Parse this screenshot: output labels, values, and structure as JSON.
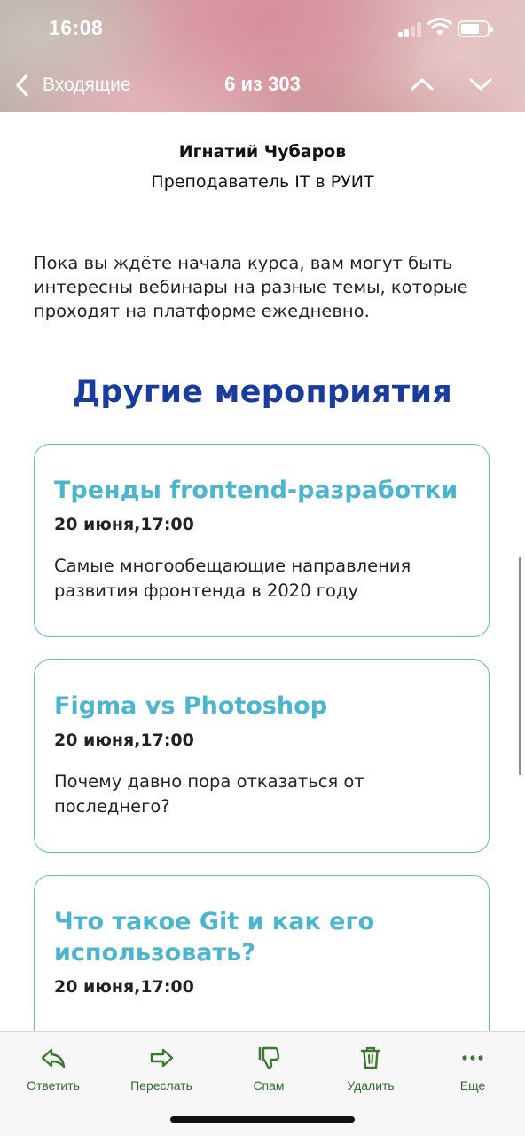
{
  "status_bar": {
    "time": "16:08"
  },
  "nav": {
    "back_label": "Входящие",
    "counter": "6 из 303"
  },
  "sender": {
    "name": "Игнатий Чубаров",
    "role": "Преподаватель IT в РУИТ"
  },
  "intro_text": "Пока вы ждёте начала курса, вам могут быть интересны вебинары на разные темы, которые проходят на платформе ежедневно.",
  "section_title": "Другие мероприятия",
  "events": [
    {
      "title": "Тренды frontend-разработки",
      "date": "20 июня,17:00",
      "description": "Самые многообещающие направления развития фронтенда в 2020 году"
    },
    {
      "title": "Figma vs Photoshop",
      "date": "20 июня,17:00",
      "description": "Почему давно пора отказаться от последнего?"
    },
    {
      "title": "Что такое Git и как его использовать?",
      "date": "20 июня,17:00",
      "description": ""
    }
  ],
  "toolbar": {
    "reply": "Ответить",
    "forward": "Переслать",
    "spam": "Спам",
    "delete": "Удалить",
    "more": "Еще"
  },
  "colors": {
    "title_blue": "#1a3c9c",
    "card_accent": "#4cb6cf",
    "toolbar_green": "#2e6b2e"
  }
}
